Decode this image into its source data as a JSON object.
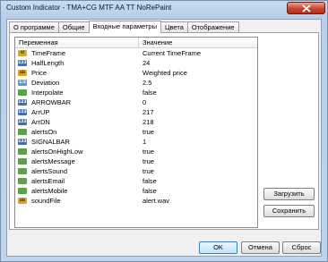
{
  "window": {
    "title": "Custom Indicator - TMA+CG MTF AA TT NoRePaint"
  },
  "tabs": [
    "О программе",
    "Общие",
    "Входные параметры",
    "Цвета",
    "Отображение"
  ],
  "grid": {
    "headers": [
      "Переменная",
      "Значение"
    ],
    "rows": [
      {
        "icon": "tf",
        "name": "TimeFrame",
        "value": "Current TimeFrame"
      },
      {
        "icon": "int",
        "name": "HalfLength",
        "value": "24"
      },
      {
        "icon": "str",
        "name": "Price",
        "value": "Weighted price"
      },
      {
        "icon": "dbl",
        "name": "Deviation",
        "value": "2.5"
      },
      {
        "icon": "bool",
        "name": "Interpolate",
        "value": "false"
      },
      {
        "icon": "int",
        "name": "ARROWBAR",
        "value": "0"
      },
      {
        "icon": "int",
        "name": "ArrUP",
        "value": "217"
      },
      {
        "icon": "int",
        "name": "ArrDN",
        "value": "218"
      },
      {
        "icon": "bool",
        "name": "alertsOn",
        "value": "true"
      },
      {
        "icon": "int",
        "name": "SIGNALBAR",
        "value": "1"
      },
      {
        "icon": "bool",
        "name": "alertsOnHighLow",
        "value": "true"
      },
      {
        "icon": "bool",
        "name": "alertsMessage",
        "value": "true"
      },
      {
        "icon": "bool",
        "name": "alertsSound",
        "value": "true"
      },
      {
        "icon": "bool",
        "name": "alertsEmail",
        "value": "false"
      },
      {
        "icon": "bool",
        "name": "alertsMobile",
        "value": "false"
      },
      {
        "icon": "str",
        "name": "soundFile",
        "value": "alert.wav"
      }
    ]
  },
  "icons": {
    "int": "123",
    "dbl": "1/2",
    "bool": "",
    "str": "ab",
    "tf": "tf"
  },
  "buttons": {
    "load": "Загрузить",
    "save": "Сохранить",
    "ok": "OK",
    "cancel": "Отмена",
    "reset": "Сброс"
  }
}
